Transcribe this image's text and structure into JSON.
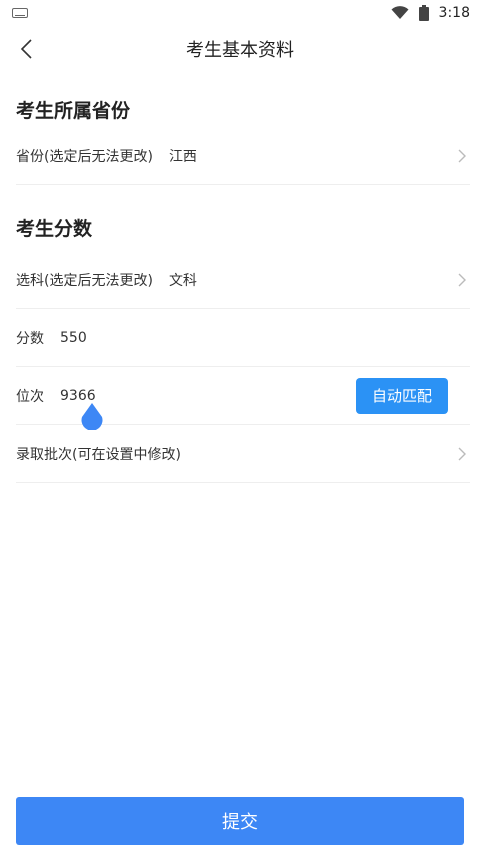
{
  "status_bar": {
    "time": "3:18",
    "icons": [
      "keyboard-icon",
      "wifi-icon",
      "battery-icon"
    ]
  },
  "header": {
    "title": "考生基本资料",
    "back_icon": "chevron-left-icon"
  },
  "sections": {
    "province": {
      "title": "考生所属省份",
      "row": {
        "label": "省份(选定后无法更改)",
        "value": "江西"
      }
    },
    "score": {
      "title": "考生分数",
      "subject": {
        "label": "选科(选定后无法更改)",
        "value": "文科"
      },
      "points": {
        "label": "分数",
        "value": "550"
      },
      "rank": {
        "label": "位次",
        "value": "9366",
        "button": "自动匹配"
      },
      "batch": {
        "label": "录取批次(可在设置中修改)"
      }
    }
  },
  "submit_label": "提交",
  "colors": {
    "primary": "#3d87f5",
    "button_blue": "#2b92f5",
    "divider": "#eeeeee"
  }
}
